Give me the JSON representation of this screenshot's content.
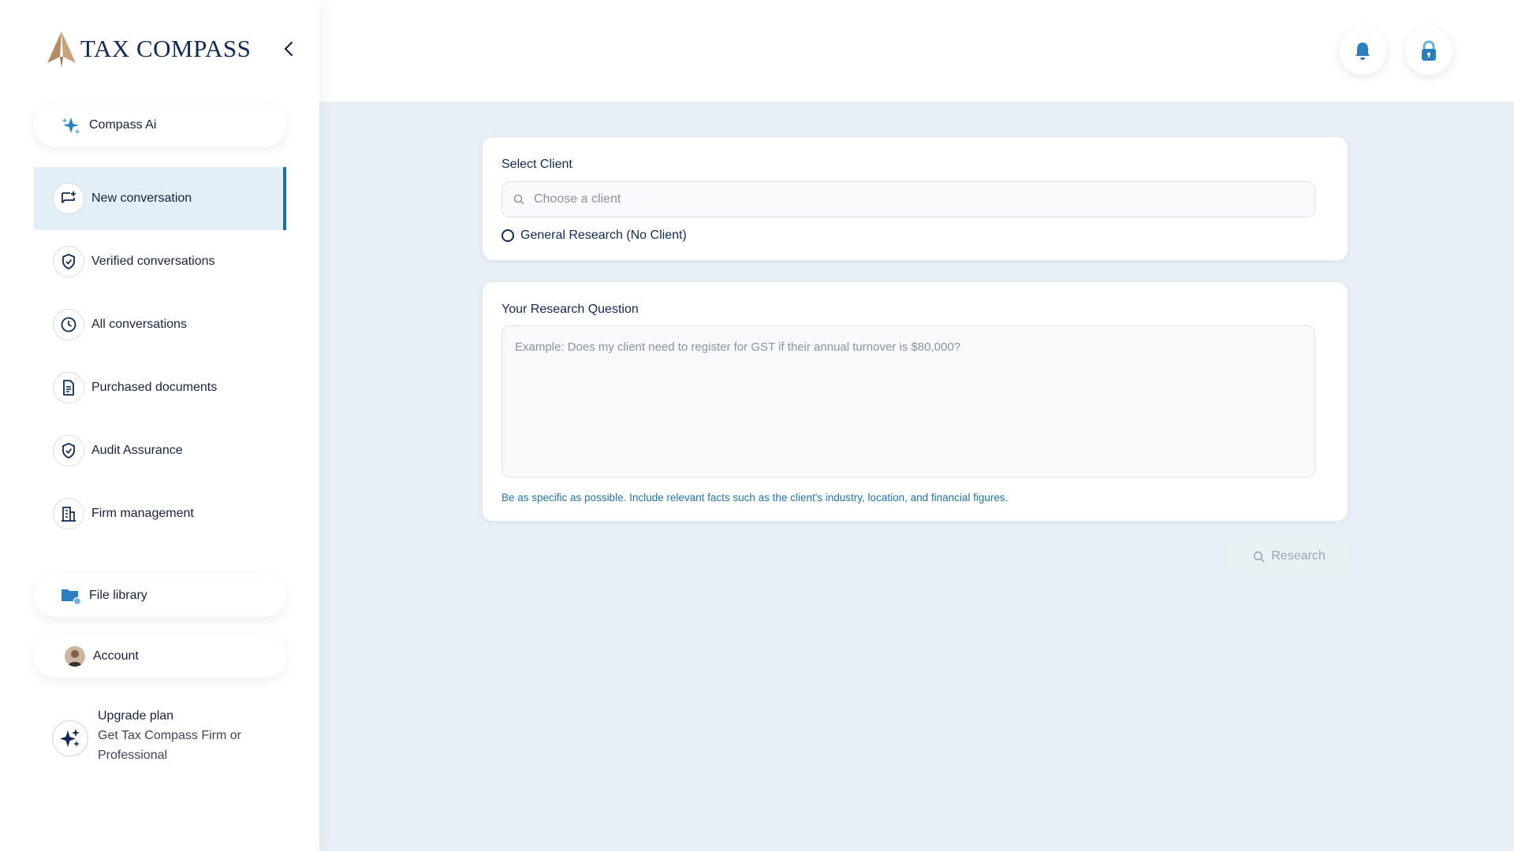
{
  "brand": {
    "name": "TAX COMPASS"
  },
  "sidebar": {
    "compass_ai": "Compass Ai",
    "nav": [
      {
        "label": "New conversation",
        "icon": "chat-plus-icon",
        "active": true
      },
      {
        "label": "Verified conversations",
        "icon": "shield-check-icon",
        "active": false
      },
      {
        "label": "All conversations",
        "icon": "clock-icon",
        "active": false
      },
      {
        "label": "Purchased documents",
        "icon": "document-icon",
        "active": false
      },
      {
        "label": "Audit Assurance",
        "icon": "shield-check-icon",
        "active": false
      },
      {
        "label": "Firm management",
        "icon": "building-icon",
        "active": false
      }
    ],
    "file_library": "File library",
    "account": "Account",
    "upgrade": {
      "title": "Upgrade plan",
      "subtitle": "Get Tax Compass Firm or Professional"
    }
  },
  "client_card": {
    "title": "Select Client",
    "search_placeholder": "Choose a client",
    "general_option": "General Research (No Client)"
  },
  "question_card": {
    "title": "Your Research Question",
    "placeholder": "Example: Does my client need to register for GST if their annual turnover is $80,000?",
    "hint": "Be as specific as possible. Include relevant facts such as the client's industry, location, and financial figures."
  },
  "research_button": "Research",
  "colors": {
    "accent": "#1a6fa8",
    "navy": "#0f2a55",
    "background": "#e6f0f5"
  }
}
